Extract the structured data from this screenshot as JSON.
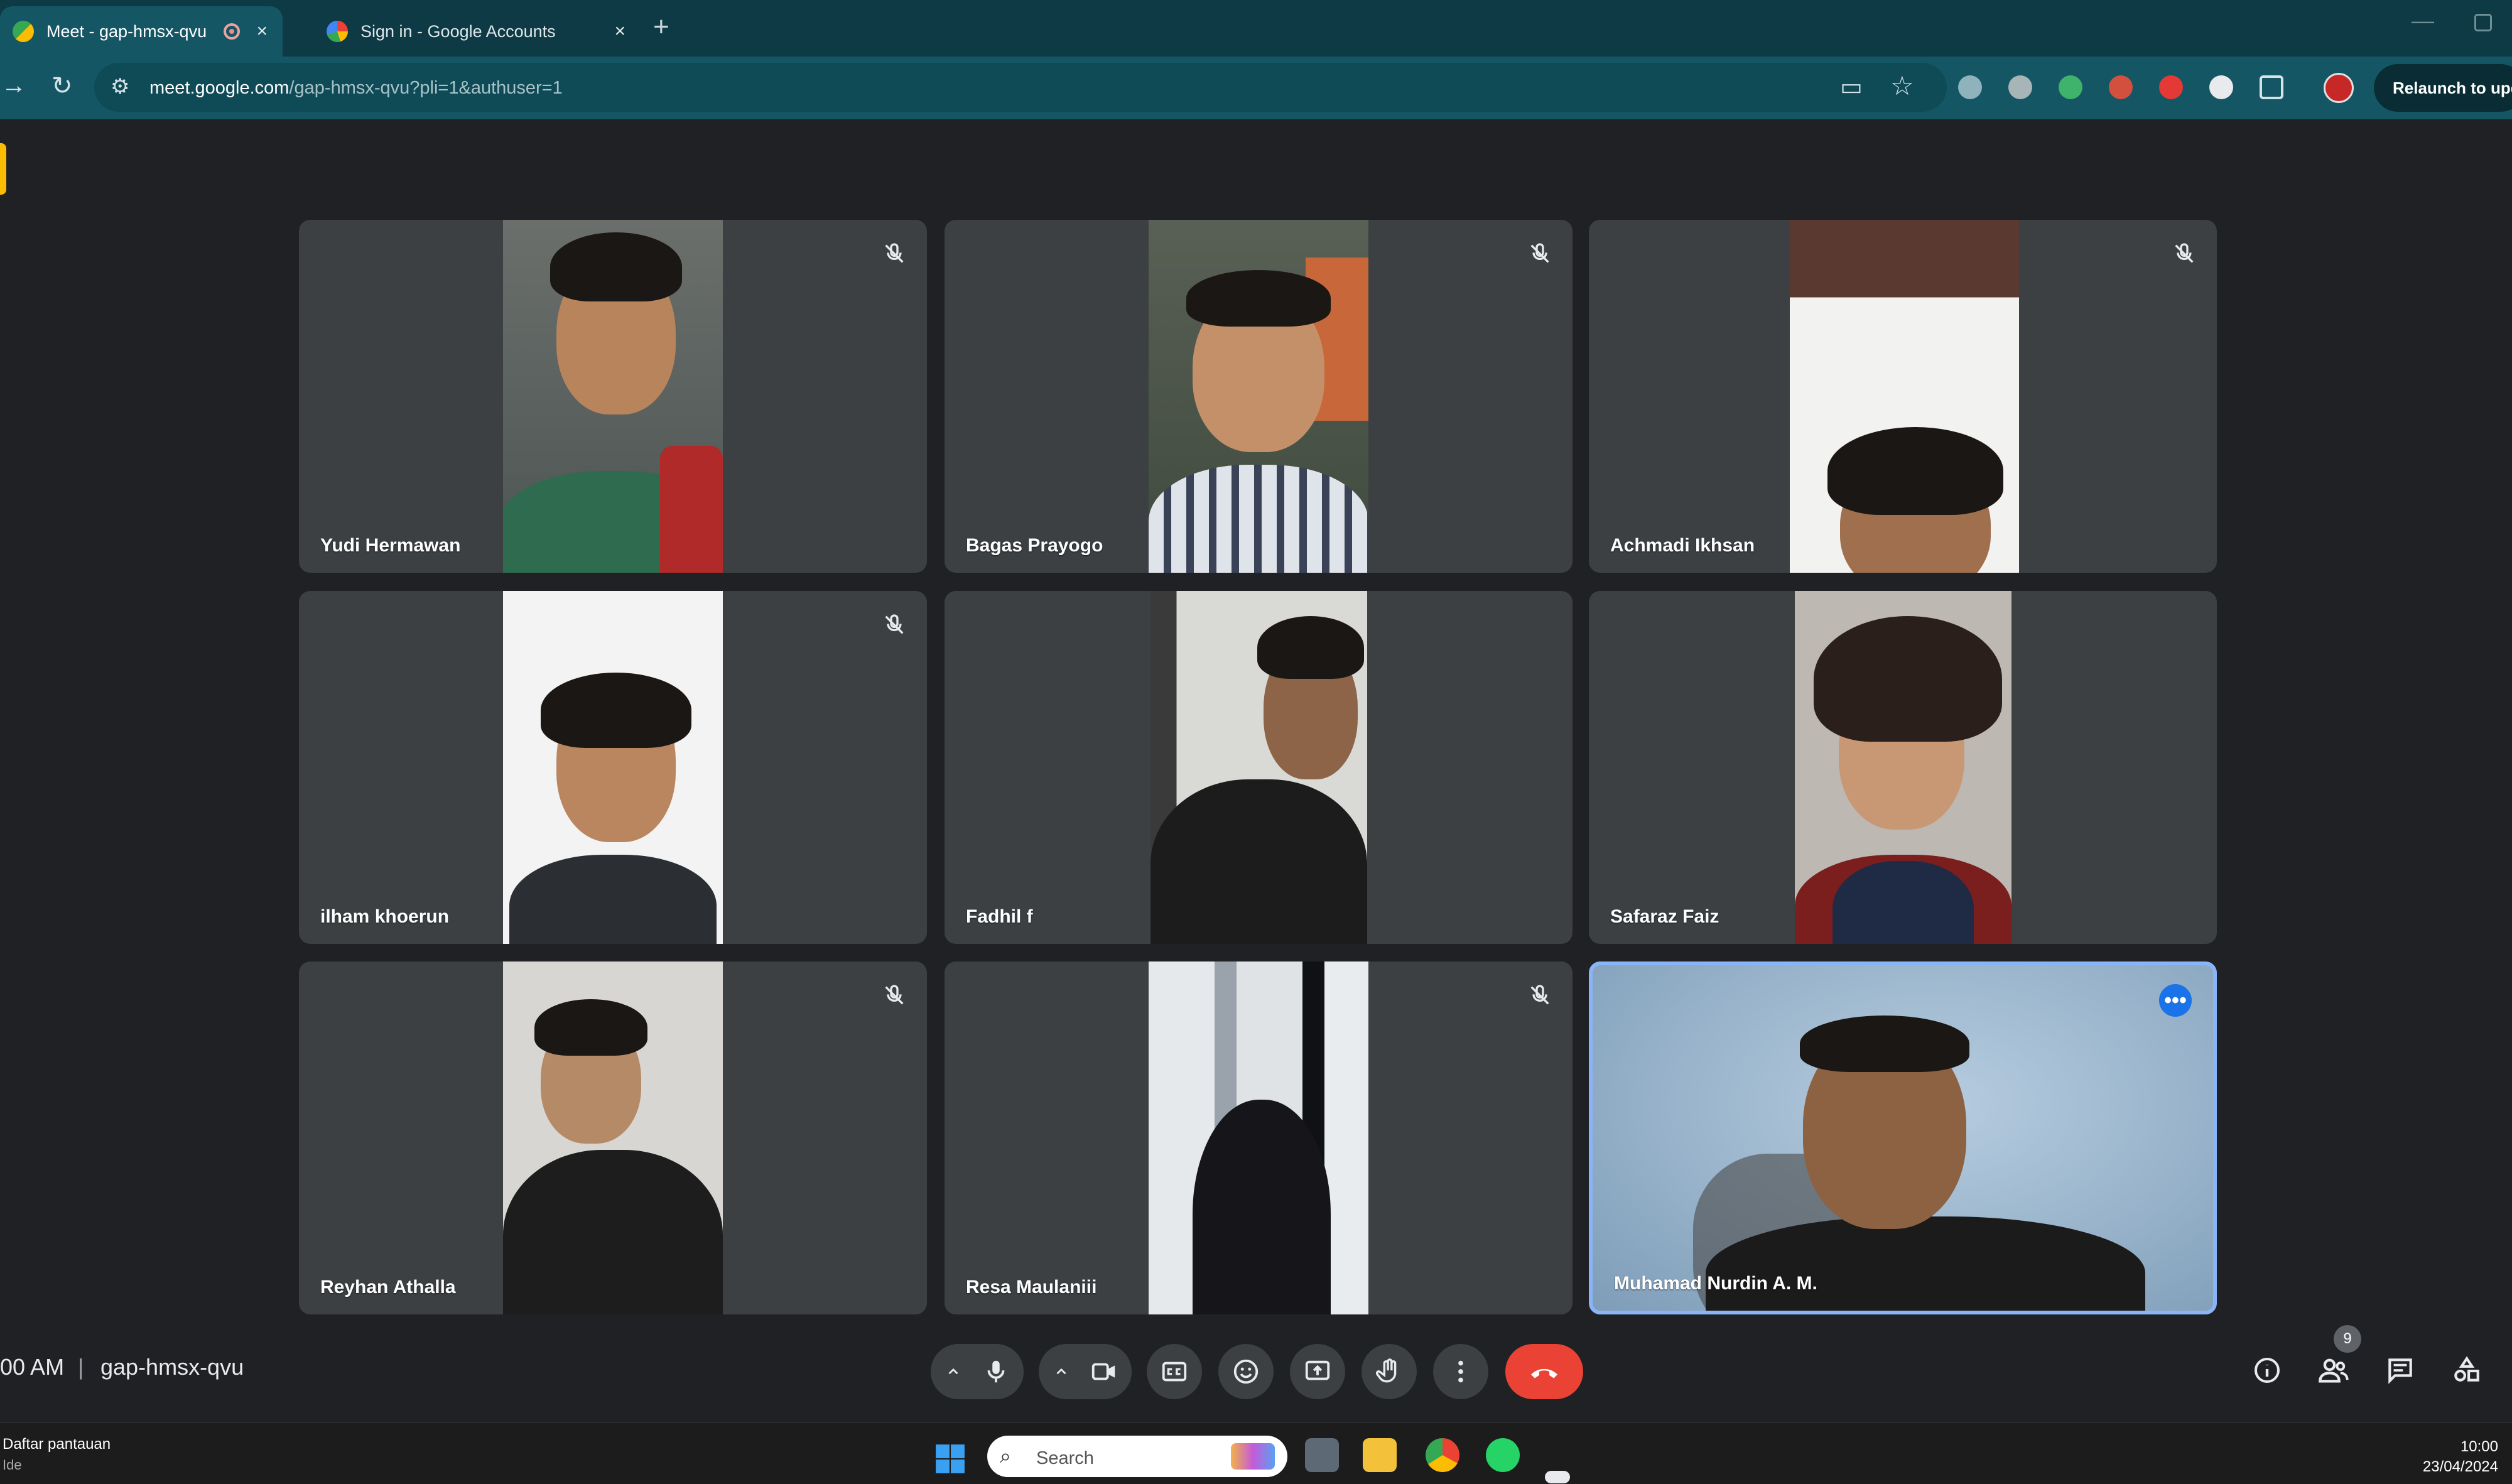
{
  "browser": {
    "tabs": [
      {
        "title": "Meet - gap-hmsx-qvu",
        "active": true
      },
      {
        "title": "Sign in - Google Accounts",
        "active": false
      }
    ],
    "new_tab_label": "+",
    "tab_close_label": "×",
    "address_bar": {
      "host": "meet.google.com",
      "path": "/gap-hmsx-qvu?pli=1&authuser=1"
    },
    "relaunch_label": "Relaunch to upd"
  },
  "meet": {
    "participants": [
      {
        "name": "Yudi Hermawan",
        "muted": true
      },
      {
        "name": "Bagas Prayogo",
        "muted": true
      },
      {
        "name": "Achmadi Ikhsan",
        "muted": true
      },
      {
        "name": "ilham khoerun",
        "muted": true
      },
      {
        "name": "Fadhil f",
        "muted": false
      },
      {
        "name": "Safaraz Faiz",
        "muted": false
      },
      {
        "name": "Reyhan Athalla",
        "muted": true
      },
      {
        "name": "Resa Maulaniii",
        "muted": true
      },
      {
        "name": "Muhamad Nurdin A. M.",
        "muted": false,
        "speaking": true
      }
    ],
    "time": "00 AM",
    "separator": "|",
    "meeting_code": "gap-hmsx-qvu",
    "people_count": "9",
    "more_label": "•••"
  },
  "taskbar": {
    "widget_title": "Daftar pantauan",
    "widget_sub": "Ide",
    "search_placeholder": "Search",
    "clock_time": "10:00",
    "clock_date": "23/04/2024"
  },
  "colors": {
    "accent_blue": "#1a73e8",
    "end_call_red": "#ea4335",
    "tile_bg": "#3c4043",
    "speaking_border": "#8ab4f8",
    "tab_bar": "#0d3a45"
  }
}
